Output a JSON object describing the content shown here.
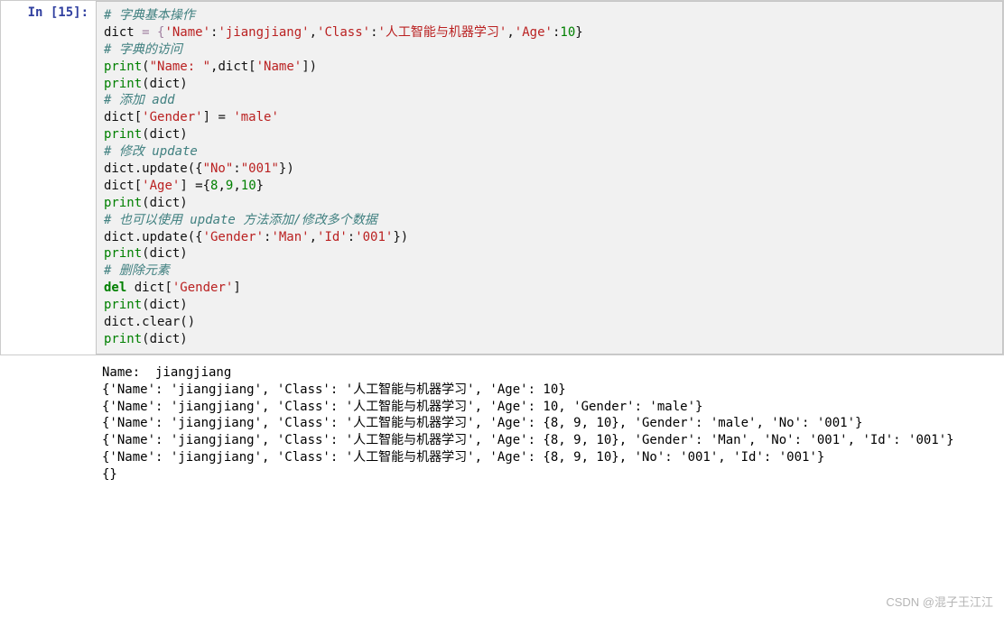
{
  "cell": {
    "prompt": "In [15]:",
    "code": {
      "l1": "# 字典基本操作",
      "l2a": "dict",
      "l2b": " = {",
      "l2c": "'Name'",
      "l2d": ":",
      "l2e": "'jiangjiang'",
      "l2f": ",",
      "l2g": "'Class'",
      "l2h": ":",
      "l2i": "'人工智能与机器学习'",
      "l2j": ",",
      "l2k": "'Age'",
      "l2l": ":",
      "l2m": "10",
      "l2n": "}",
      "l3": "# 字典的访问",
      "l4a": "print",
      "l4b": "(",
      "l4c": "\"Name: \"",
      "l4d": ",dict[",
      "l4e": "'Name'",
      "l4f": "])",
      "l5a": "print",
      "l5b": "(dict)",
      "l6": "# 添加 add",
      "l7a": "dict[",
      "l7b": "'Gender'",
      "l7c": "] = ",
      "l7d": "'male'",
      "l8a": "print",
      "l8b": "(dict)",
      "l9": "# 修改 update",
      "l10a": "dict.update({",
      "l10b": "\"No\"",
      "l10c": ":",
      "l10d": "\"001\"",
      "l10e": "})",
      "l11a": "dict[",
      "l11b": "'Age'",
      "l11c": "] ={",
      "l11d": "8",
      "l11e": ",",
      "l11f": "9",
      "l11g": ",",
      "l11h": "10",
      "l11i": "}",
      "l12a": "print",
      "l12b": "(dict)",
      "l13": "# 也可以使用 update 方法添加/修改多个数据",
      "l14a": "dict.update({",
      "l14b": "'Gender'",
      "l14c": ":",
      "l14d": "'Man'",
      "l14e": ",",
      "l14f": "'Id'",
      "l14g": ":",
      "l14h": "'001'",
      "l14i": "})",
      "l15a": "print",
      "l15b": "(dict)",
      "l16": "# 删除元素",
      "l17a": "del",
      "l17b": " dict[",
      "l17c": "'Gender'",
      "l17d": "]",
      "l18a": "print",
      "l18b": "(dict)",
      "l19": "dict.clear()",
      "l20a": "print",
      "l20b": "(dict)"
    }
  },
  "output": "Name:  jiangjiang\n{'Name': 'jiangjiang', 'Class': '人工智能与机器学习', 'Age': 10}\n{'Name': 'jiangjiang', 'Class': '人工智能与机器学习', 'Age': 10, 'Gender': 'male'}\n{'Name': 'jiangjiang', 'Class': '人工智能与机器学习', 'Age': {8, 9, 10}, 'Gender': 'male', 'No': '001'}\n{'Name': 'jiangjiang', 'Class': '人工智能与机器学习', 'Age': {8, 9, 10}, 'Gender': 'Man', 'No': '001', 'Id': '001'}\n{'Name': 'jiangjiang', 'Class': '人工智能与机器学习', 'Age': {8, 9, 10}, 'No': '001', 'Id': '001'}\n{}",
  "watermark": "CSDN @混子王江江"
}
